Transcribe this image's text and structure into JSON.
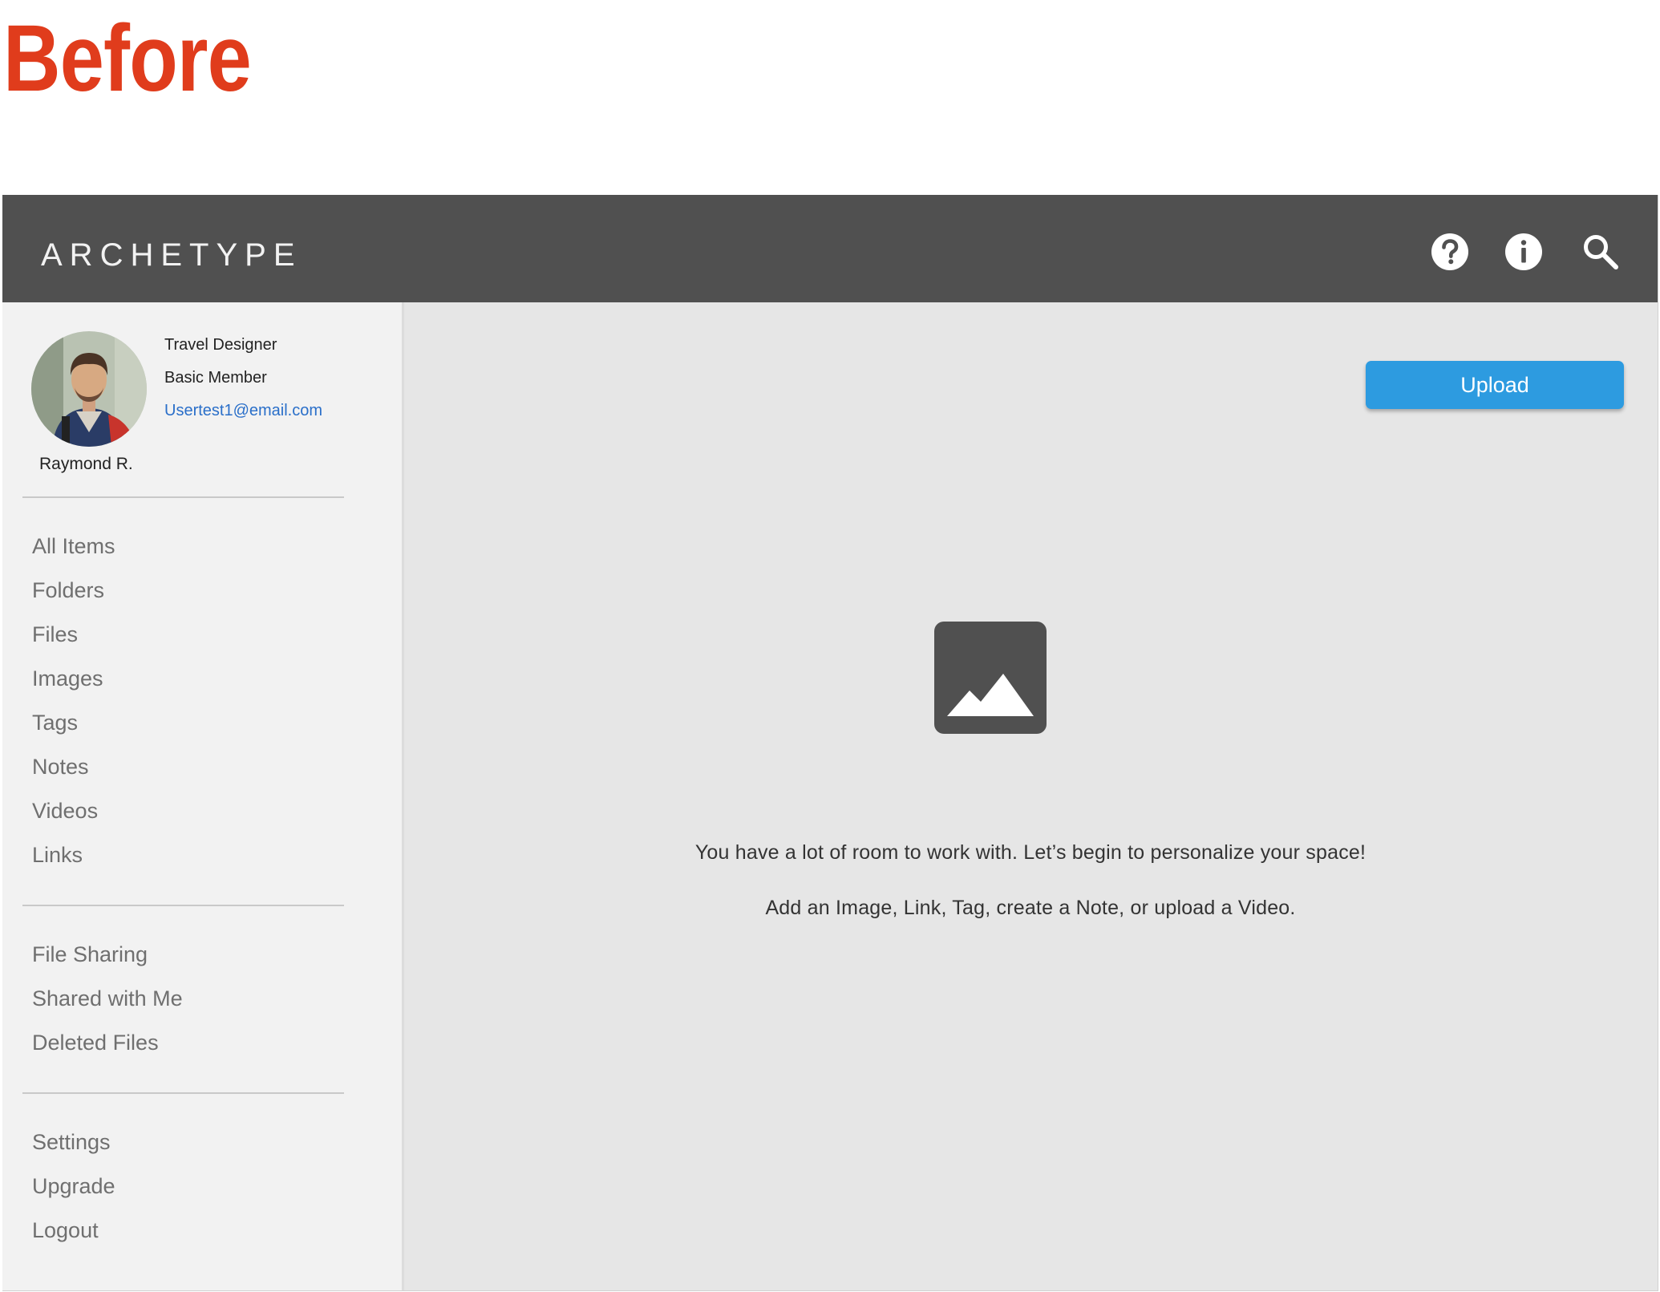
{
  "slide_label": "Before",
  "header": {
    "brand": "ARCHETYPE",
    "icons": [
      "help-icon",
      "info-icon",
      "search-icon"
    ]
  },
  "profile": {
    "role": "Travel Designer",
    "membership": "Basic Member",
    "email": "Usertest1@email.com",
    "name": "Raymond R."
  },
  "sidebar": {
    "library_items": [
      "All Items",
      "Folders",
      "Files",
      "Images",
      "Tags",
      "Notes",
      "Videos",
      "Links"
    ],
    "sharing_items": [
      "File Sharing",
      "Shared with Me",
      "Deleted Files"
    ],
    "account_items": [
      "Settings",
      "Upgrade",
      "Logout"
    ]
  },
  "main": {
    "upload_label": "Upload",
    "empty_state": {
      "icon": "image-placeholder-icon",
      "line1": "You have a lot of room to work with.  Let’s begin to personalize your space!",
      "line2": "Add an Image, Link, Tag, create a Note, or upload a Video."
    }
  },
  "colors": {
    "slide_label": "#e03c1c",
    "topbar": "#505050",
    "sidebar_bg": "#f2f2f2",
    "main_bg": "#e6e6e6",
    "upload_button": "#2d9be0",
    "email_link": "#2a6fc9"
  }
}
